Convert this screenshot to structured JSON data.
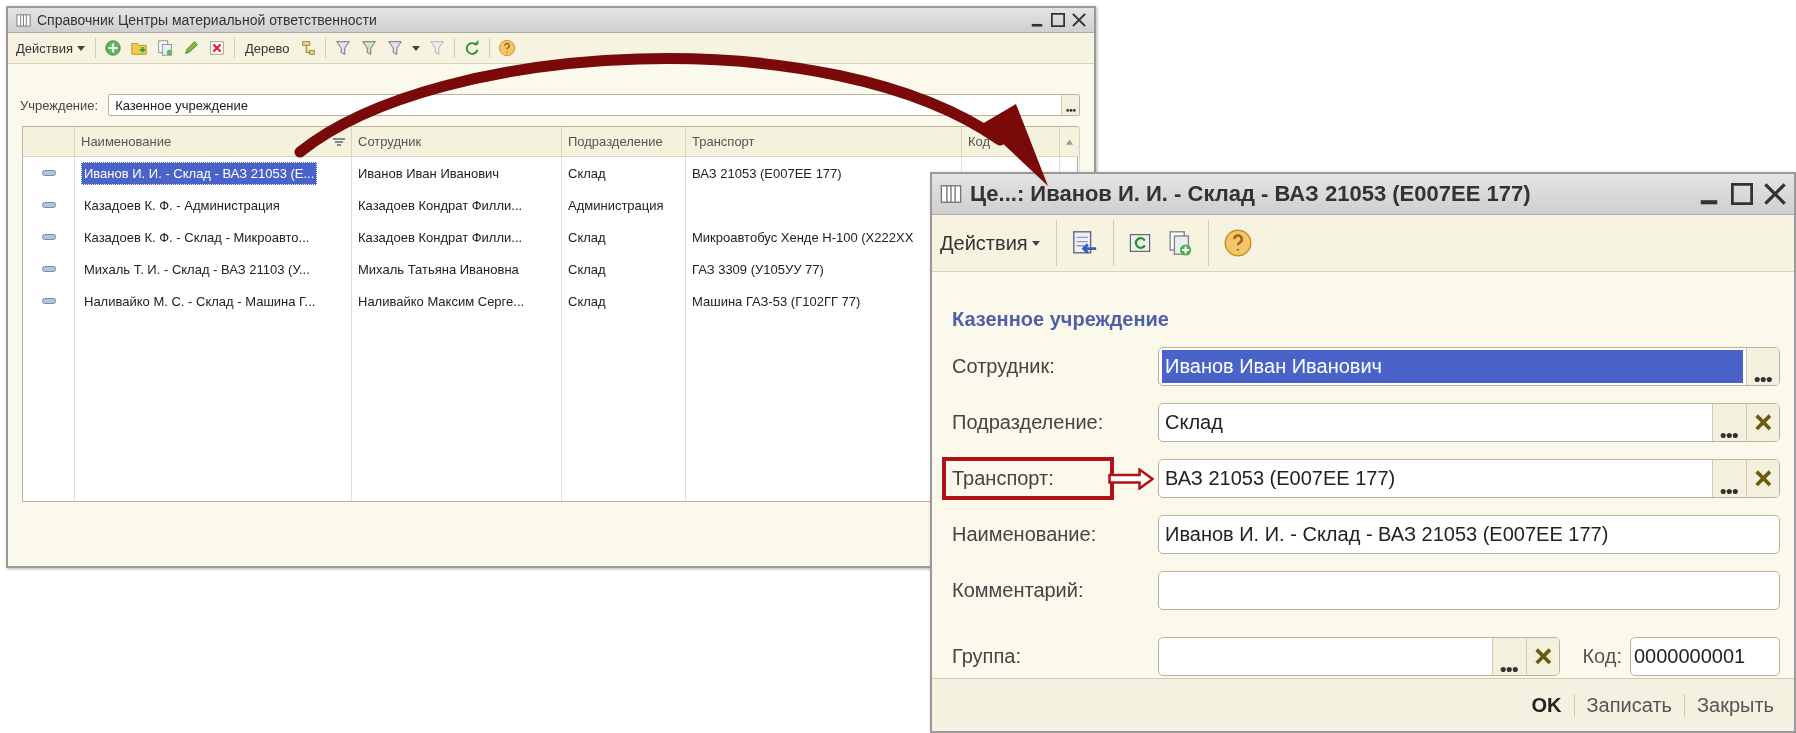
{
  "list_window": {
    "title": "Справочник Центры материальной ответственности",
    "toolbar": {
      "menu": "Действия",
      "tree_button": "Дерево"
    },
    "filter": {
      "label": "Учреждение:",
      "value": "Казенное учреждение"
    },
    "table": {
      "columns": [
        "Наименование",
        "Сотрудник",
        "Подразделение",
        "Транспорт",
        "Код"
      ],
      "rows": [
        {
          "name": "Иванов И. И. - Склад - ВАЗ 21053 (Е...",
          "employee": "Иванов Иван Иванович",
          "department": "Склад",
          "transport": "ВАЗ 21053 (Е007ЕЕ 177)",
          "selected": true
        },
        {
          "name": "Казадоев К. Ф. - Администрация",
          "employee": "Казадоев Кондрат Филли...",
          "department": "Администрация",
          "selected": false
        },
        {
          "name": "Казадоев К. Ф. - Склад - Микроавто...",
          "employee": "Казадоев Кондрат Филли...",
          "department": "Склад",
          "transport": "Микроавтобус Хенде Н-100 (Х222ХХ",
          "selected": false
        },
        {
          "name": "Михаль Т. И. - Склад - ВАЗ 21103 (У...",
          "employee": "Михаль Татьяна Ивановна",
          "department": "Склад",
          "transport": "ГАЗ 3309 (У105УУ 77)",
          "selected": false
        },
        {
          "name": "Наливайко М. С. - Склад - Машина Г...",
          "employee": "Наливайко Максим Серге...",
          "department": "Склад",
          "transport": "Машина ГАЗ-53 (Г102ГГ 77)",
          "selected": false
        }
      ]
    }
  },
  "item_window": {
    "title": "Це...: Иванов И. И. - Склад - ВАЗ 21053 (Е007ЕЕ 177)",
    "toolbar": {
      "menu": "Действия"
    },
    "heading": "Казенное учреждение",
    "fields": [
      {
        "label": "Сотрудник:",
        "value": "Иванов Иван Иванович",
        "kind": "select",
        "focused": true,
        "highlighted": false
      },
      {
        "label": "Подразделение:",
        "value": "Склад",
        "kind": "select_clear",
        "focused": false,
        "highlighted": false
      },
      {
        "label": "Транспорт:",
        "value": "ВАЗ 21053 (Е007ЕЕ 177)",
        "kind": "select_clear",
        "focused": false,
        "highlighted": true
      },
      {
        "label": "Наименование:",
        "value": "Иванов И. И. - Склад - ВАЗ 21053 (Е007ЕЕ 177)",
        "kind": "text",
        "focused": false,
        "highlighted": false
      },
      {
        "label": "Комментарий:",
        "kind": "text",
        "focused": false,
        "highlighted": false
      }
    ],
    "group": {
      "label": "Группа:",
      "code_label": "Код:",
      "code": "0000000001"
    },
    "buttons": [
      {
        "label": "OK",
        "default": true
      },
      {
        "label": "Записать",
        "default": false
      },
      {
        "label": "Закрыть",
        "default": false
      }
    ]
  }
}
